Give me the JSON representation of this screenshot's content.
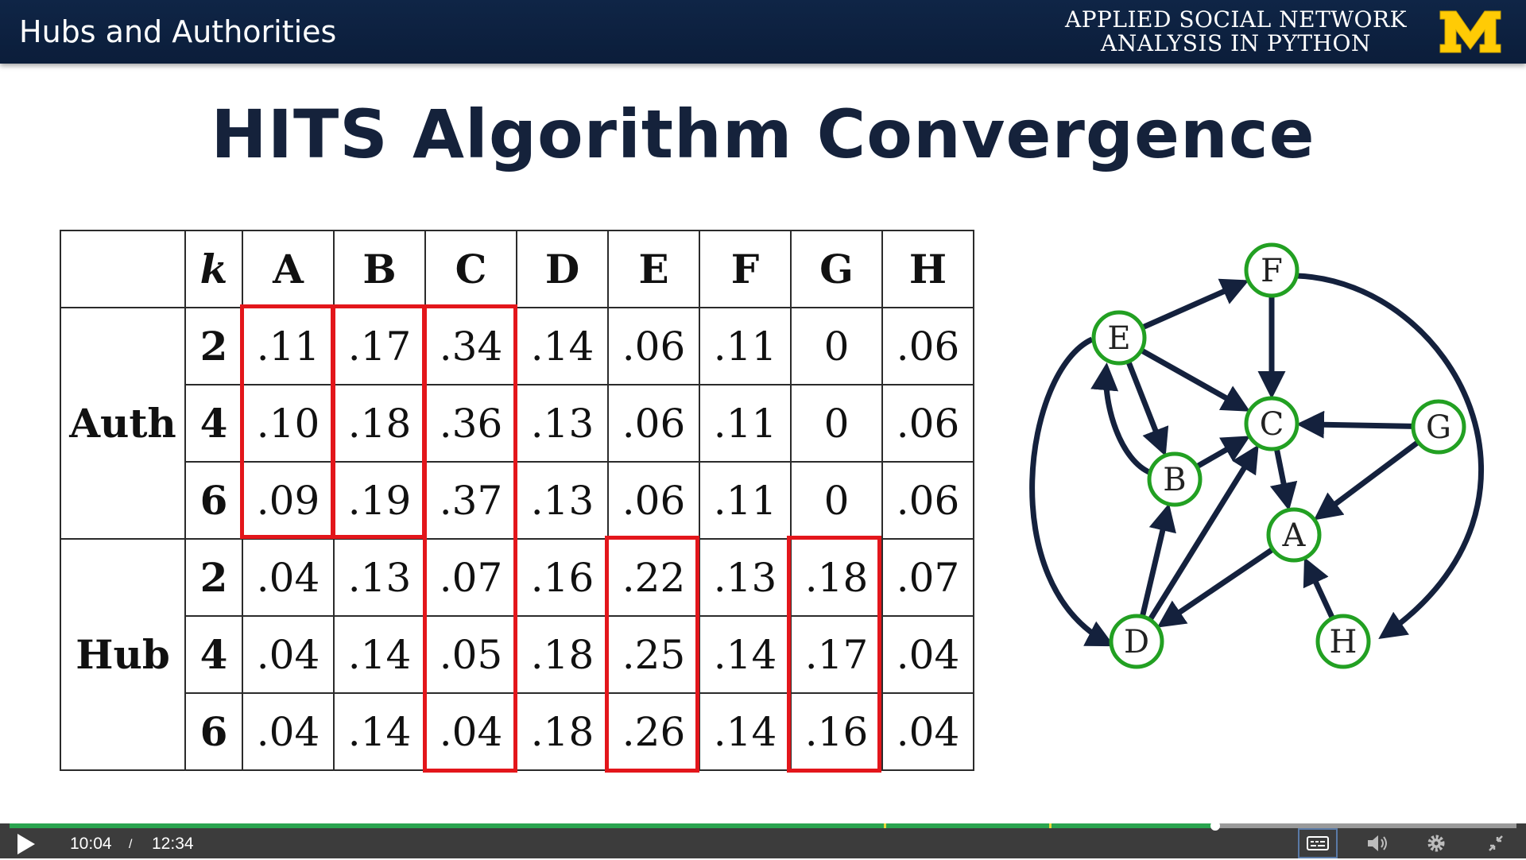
{
  "header": {
    "lesson_title": "Hubs and Authorities",
    "course_line1": "APPLIED SOCIAL NETWORK",
    "course_line2": "ANALYSIS IN PYTHON",
    "logo_letter": "M",
    "brand_colors": {
      "navy": "#0b1d3a",
      "maize": "#ffcb05"
    }
  },
  "slide": {
    "title": "HITS Algorithm Convergence",
    "table": {
      "k_header": "k",
      "columns": [
        "A",
        "B",
        "C",
        "D",
        "E",
        "F",
        "G",
        "H"
      ],
      "groups": [
        {
          "label": "Auth",
          "rows": [
            {
              "k": "2",
              "values": [
                ".11",
                ".17",
                ".34",
                ".14",
                ".06",
                ".11",
                "0",
                ".06"
              ]
            },
            {
              "k": "4",
              "values": [
                ".10",
                ".18",
                ".36",
                ".13",
                ".06",
                ".11",
                "0",
                ".06"
              ]
            },
            {
              "k": "6",
              "values": [
                ".09",
                ".19",
                ".37",
                ".13",
                ".06",
                ".11",
                "0",
                ".06"
              ]
            }
          ]
        },
        {
          "label": "Hub",
          "rows": [
            {
              "k": "2",
              "values": [
                ".04",
                ".13",
                ".07",
                ".16",
                ".22",
                ".13",
                ".18",
                ".07"
              ]
            },
            {
              "k": "4",
              "values": [
                ".04",
                ".14",
                ".05",
                ".18",
                ".25",
                ".14",
                ".17",
                ".04"
              ]
            },
            {
              "k": "6",
              "values": [
                ".04",
                ".14",
                ".04",
                ".18",
                ".26",
                ".14",
                ".16",
                ".04"
              ]
            }
          ]
        }
      ],
      "highlight_color": "#e3161b"
    },
    "graph": {
      "nodes": [
        "F",
        "E",
        "C",
        "G",
        "B",
        "A",
        "D",
        "H"
      ],
      "edges": [
        [
          "E",
          "F"
        ],
        [
          "F",
          "C"
        ],
        [
          "F",
          "H"
        ],
        [
          "E",
          "C"
        ],
        [
          "E",
          "B"
        ],
        [
          "B",
          "E"
        ],
        [
          "B",
          "C"
        ],
        [
          "E",
          "D"
        ],
        [
          "D",
          "B"
        ],
        [
          "D",
          "C"
        ],
        [
          "C",
          "A"
        ],
        [
          "G",
          "C"
        ],
        [
          "G",
          "A"
        ],
        [
          "A",
          "D"
        ],
        [
          "H",
          "A"
        ]
      ],
      "node_stroke": "#22a022",
      "edge_color": "#14213d"
    }
  },
  "player": {
    "current_time": "10:04",
    "separator": "/",
    "duration": "12:34",
    "progress": 0.8,
    "colors": {
      "fill": "#2aa44f",
      "bar": "#3c3c3c"
    }
  }
}
